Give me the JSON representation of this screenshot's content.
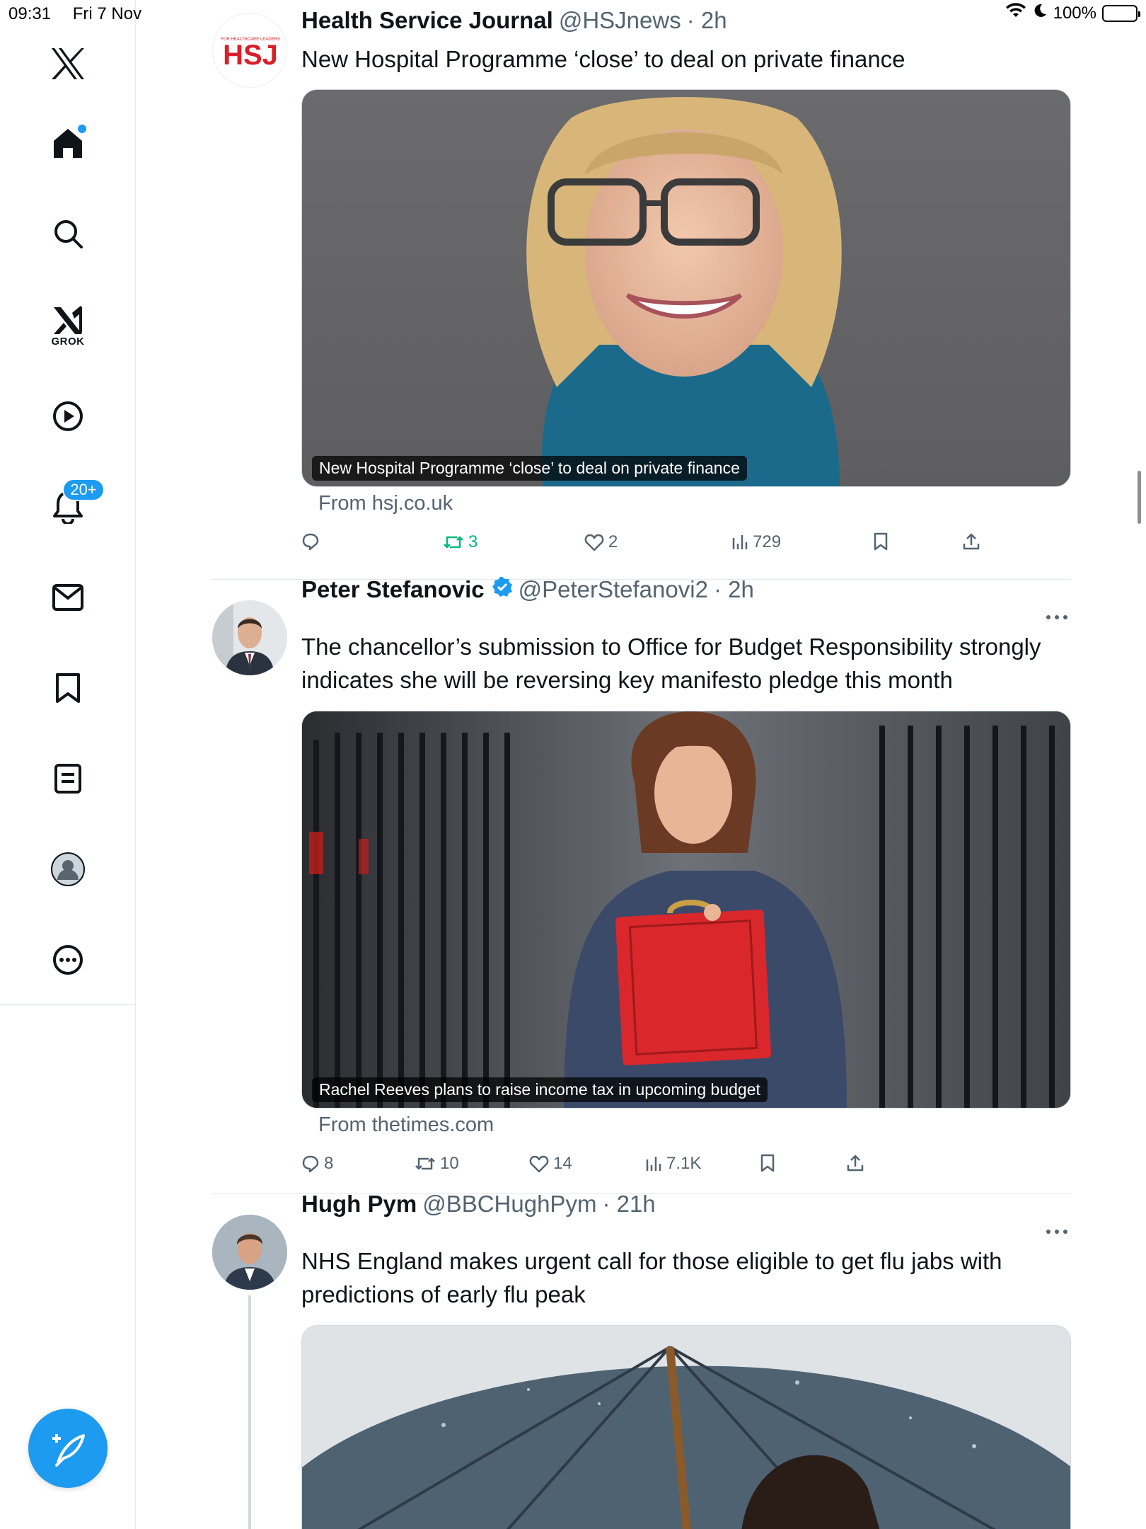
{
  "status_bar": {
    "time": "09:31",
    "date": "Fri 7 Nov",
    "battery": "100%"
  },
  "sidebar": {
    "items": [
      {
        "name": "x-logo"
      },
      {
        "name": "home"
      },
      {
        "name": "explore"
      },
      {
        "name": "grok",
        "label": "GROK"
      },
      {
        "name": "video"
      },
      {
        "name": "notifications",
        "badge": "20+"
      },
      {
        "name": "messages"
      },
      {
        "name": "bookmarks"
      },
      {
        "name": "lists"
      },
      {
        "name": "profile"
      },
      {
        "name": "more"
      }
    ],
    "accent": "#1d9bf0"
  },
  "tweets": [
    {
      "name": "Health Service Journal",
      "handle": "@HSJnews",
      "time": "· 2h",
      "text": "New Hospital Programme ‘close’ to deal on private finance",
      "media_caption": "New Hospital Programme ‘close’ to deal on private finance",
      "source": "From hsj.co.uk",
      "replies": "",
      "retweets": "3",
      "likes": "2",
      "views": "729",
      "avatar_text": "HSJ",
      "avatar_tag": "FOR HEALTHCARE LEADERS"
    },
    {
      "name": "Peter Stefanovic",
      "handle": "@PeterStefanovi2",
      "time": "· 2h",
      "verified": true,
      "text": "The chancellor’s submission to Office for Budget Responsibility strongly indicates she will be reversing key manifesto pledge this month",
      "media_caption": "Rachel Reeves plans to raise income tax in upcoming budget",
      "source": "From thetimes.com",
      "replies": "8",
      "retweets": "10",
      "likes": "14",
      "views": "7.1K"
    },
    {
      "name": "Hugh Pym",
      "handle": "@BBCHughPym",
      "time": "· 21h",
      "text": "NHS England makes urgent call for those eligible to get flu jabs with predictions of early flu peak"
    }
  ],
  "colors": {
    "retweeted": "#00ba7c",
    "muted": "#536471",
    "brand_red": "#d7202a"
  }
}
